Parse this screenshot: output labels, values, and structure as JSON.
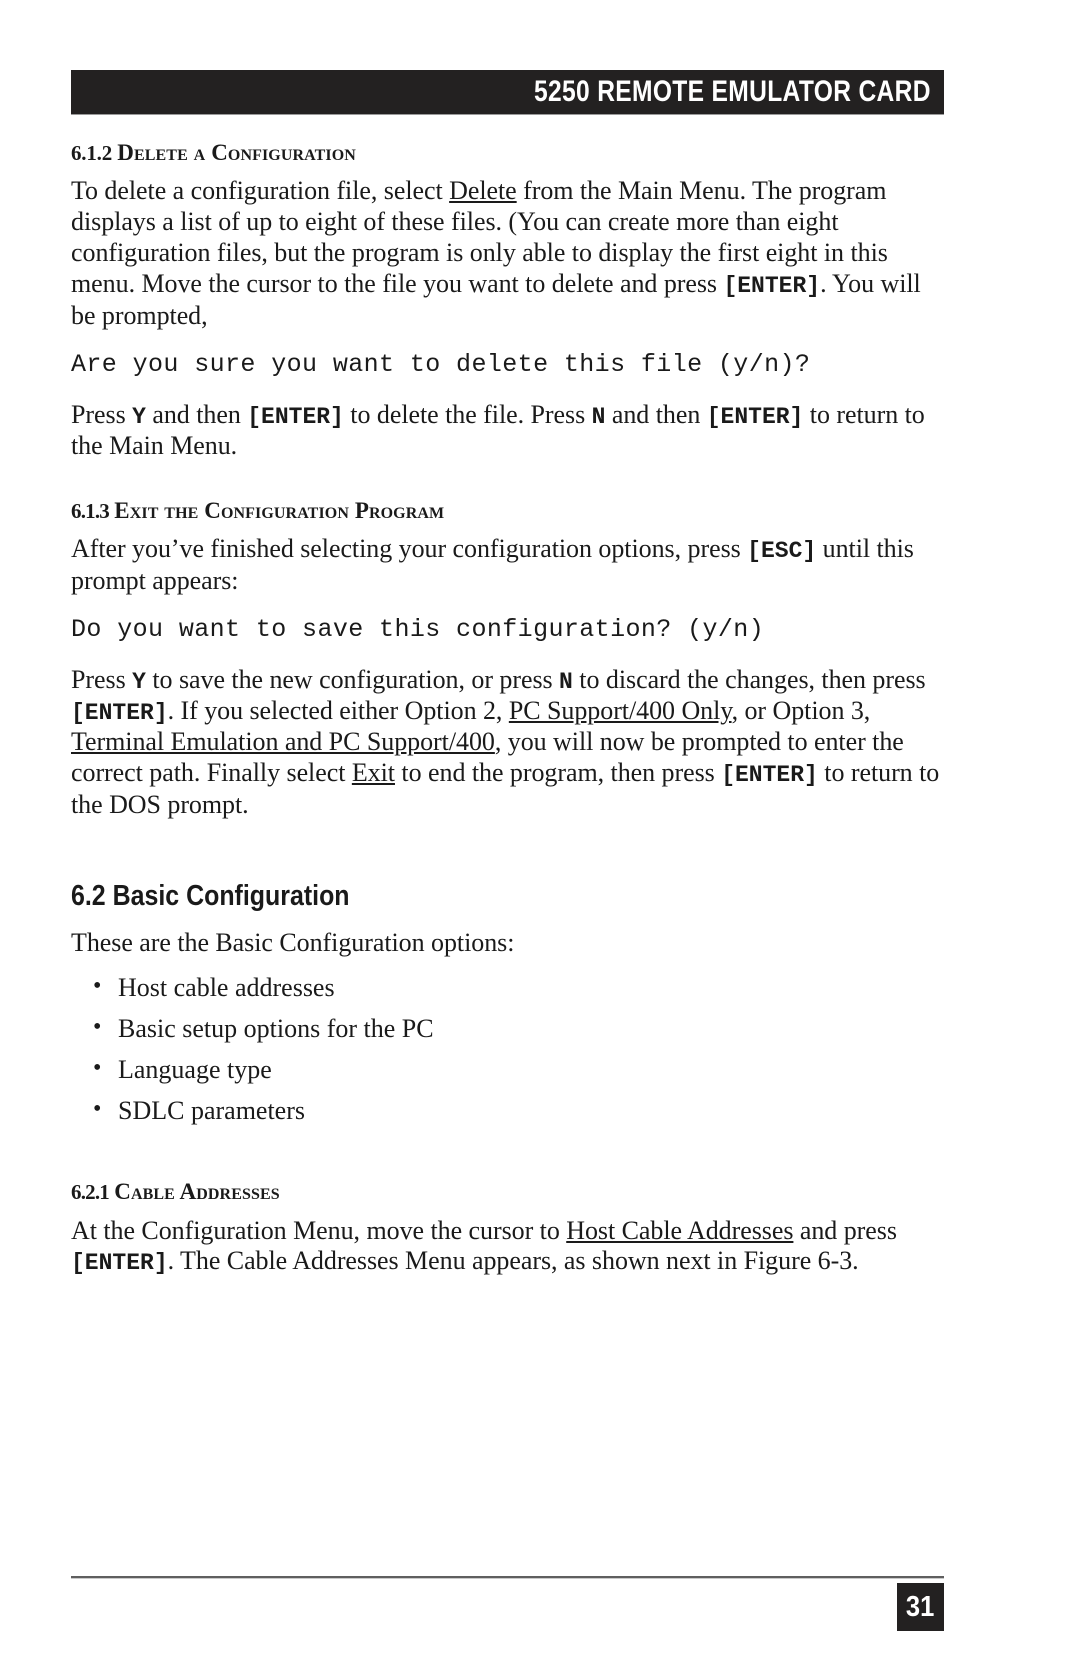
{
  "header": {
    "title": "5250 REMOTE EMULATOR CARD"
  },
  "sections": {
    "s612": {
      "number": "6.1.2",
      "title": "Delete a Configuration",
      "para1_a": "To delete a configuration file, select ",
      "para1_link": "Delete",
      "para1_b": " from the Main Menu. The program displays a list of up to eight of these files. (You can create more than eight configuration files, but the program is only able to display the first eight in this menu. Move the cursor to the file you want to delete and press ",
      "para1_key": "[ENTER]",
      "para1_c": ". You will be prompted,",
      "prompt": "Are you sure you want to delete this file (y/n)?",
      "para2_a": "Press ",
      "para2_key1": "Y",
      "para2_b": " and then ",
      "para2_key2": "[ENTER]",
      "para2_c": " to delete the file. Press ",
      "para2_key3": "N",
      "para2_d": " and then ",
      "para2_key4": "[ENTER]",
      "para2_e": " to return to the Main Menu."
    },
    "s613": {
      "number": "6.1.3",
      "title": "Exit the Configuration Program",
      "para1_a": "After you’ve finished selecting your configuration options, press ",
      "para1_key": "[ESC]",
      "para1_b": " until this prompt appears:",
      "prompt": "Do you want to save this configuration? (y/n)",
      "para2_a": "Press ",
      "para2_key1": "Y",
      "para2_b": " to save the new configuration, or press ",
      "para2_key2": "N",
      "para2_c": " to discard the changes, then press ",
      "para2_key3": "[ENTER]",
      "para2_d": ". If you selected either Option 2, ",
      "para2_link1": "PC Support/400 Only",
      "para2_e": ", or Option 3, ",
      "para2_link2": "Terminal Emulation and PC Support/400",
      "para2_f": ", you will now be prompted to enter the correct path. Finally select ",
      "para2_link3": "Exit",
      "para2_g": " to end the program, then press ",
      "para2_key4": "[ENTER]",
      "para2_h": " to return to the DOS prompt."
    },
    "s62": {
      "number": "6.2",
      "title": "6.2 Basic Configuration",
      "intro": "These are the Basic Configuration options:",
      "bullets": [
        "Host cable addresses",
        "Basic setup options for the PC",
        "Language type",
        "SDLC parameters"
      ]
    },
    "s621": {
      "number": "6.2.1",
      "title": "Cable Addresses",
      "para1_a": "At the Configuration Menu, move the cursor to ",
      "para1_link": "Host Cable Addresses",
      "para1_b": " and press ",
      "para1_key": "[ENTER]",
      "para1_c": ". The Cable Addresses Menu appears, as shown next in Figure 6-3."
    }
  },
  "footer": {
    "page_number": "31"
  }
}
